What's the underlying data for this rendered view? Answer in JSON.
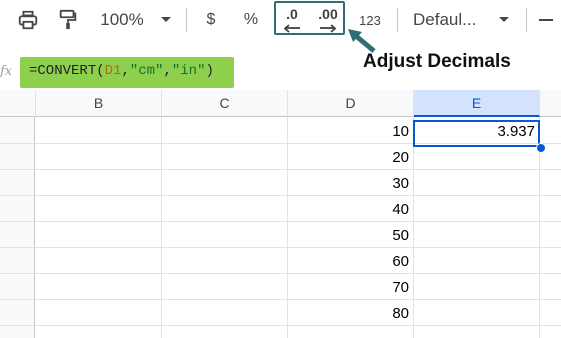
{
  "toolbar": {
    "zoom": "100%",
    "currency_symbol": "$",
    "percent_symbol": "%",
    "decrease_decimals_digits": ".0",
    "increase_decimals_digits": ".00",
    "number_format_label": "123",
    "font_label": "Defaul..."
  },
  "annotation": {
    "text": "Adjust Decimals",
    "color": "#2f6e72"
  },
  "formula_bar": {
    "fx_label": "fx",
    "eq": "=",
    "func": "CONVERT(",
    "ref": "D1",
    "comma1": ",",
    "arg2": "\"cm\"",
    "comma2": ",",
    "arg3": "\"in\"",
    "close": ")",
    "highlight_color": "#8fcf4e"
  },
  "grid": {
    "columns": [
      "B",
      "C",
      "D",
      "E"
    ],
    "selected_column": "E",
    "d_values": [
      "10",
      "20",
      "30",
      "40",
      "50",
      "60",
      "70",
      "80"
    ],
    "e_values": [
      "3.937",
      "",
      "",
      "",
      "",
      "",
      "",
      ""
    ],
    "selected_cell": "E1"
  },
  "colors": {
    "selection": "#0b57d0",
    "selected_header_bg": "#d3e3fd"
  }
}
